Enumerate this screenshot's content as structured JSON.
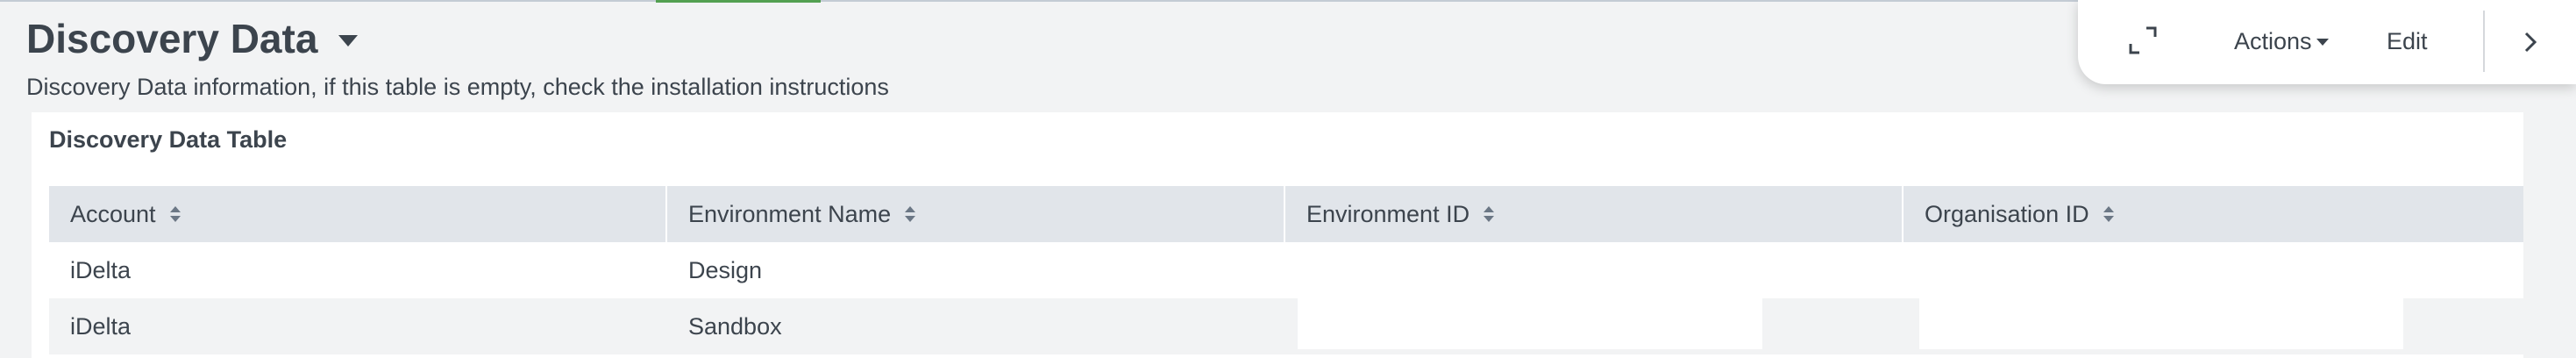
{
  "dashboard": {
    "title": "Discovery Data",
    "description": "Discovery Data information, if this table is empty, check the installation instructions"
  },
  "toolbar": {
    "expand_icon": "expand-icon",
    "actions_label": "Actions",
    "edit_label": "Edit",
    "next_icon": "chevron-right-icon"
  },
  "panel": {
    "title": "Discovery Data Table",
    "columns": [
      "Account",
      "Environment Name",
      "Environment ID",
      "Organisation ID"
    ],
    "rows": [
      [
        "iDelta",
        "Design",
        "",
        ""
      ],
      [
        "iDelta",
        "Sandbox",
        "",
        ""
      ]
    ]
  },
  "colors": {
    "background": "#f2f3f4",
    "header_row": "#e1e5ea",
    "text": "#3c444d",
    "accent": "#53a051"
  }
}
